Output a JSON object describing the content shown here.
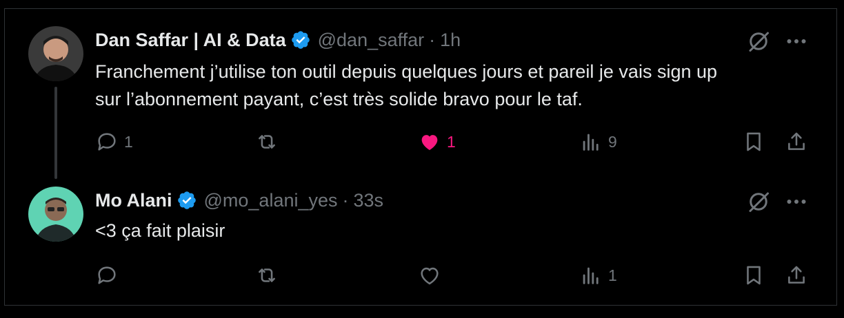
{
  "tweets": [
    {
      "author_name": "Dan Saffar | AI & Data",
      "handle": "@dan_saffar",
      "separator": "·",
      "time": "1h",
      "text_line1": "Franchement j’utilise ton outil depuis quelques jours et pareil je vais sign up",
      "text_line2": "sur l’abonnement payant, c’est très solide bravo pour le taf.",
      "replies": "1",
      "likes": "1",
      "views": "9",
      "liked": true,
      "verified": true
    },
    {
      "author_name": "Mo Alani",
      "handle": "@mo_alani_yes",
      "separator": "·",
      "time": "33s",
      "text_line1": "<3 ça fait plaisir",
      "views": "1",
      "liked": false,
      "verified": true
    }
  ],
  "icons": {
    "verified": "verified-badge-icon",
    "grok": "grok-icon",
    "more": "more-dots-icon",
    "reply": "reply-icon",
    "retweet": "retweet-icon",
    "like": "heart-icon",
    "views": "views-chart-icon",
    "bookmark": "bookmark-icon",
    "share": "share-icon"
  },
  "colors": {
    "background": "#000000",
    "text": "#e7e9ea",
    "muted": "#71767b",
    "verified_blue": "#1d9bf0",
    "like_pink": "#f91880",
    "border": "#2f3336"
  }
}
